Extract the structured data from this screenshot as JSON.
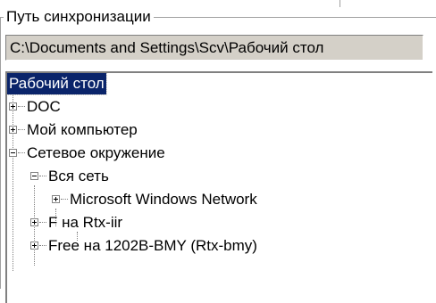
{
  "group": {
    "title": "Путь синхронизации",
    "path_value": "C:\\Documents and Settings\\Scv\\Рабочий стол"
  },
  "tree": {
    "root": "Рабочий стол",
    "items": [
      {
        "label": "DOC",
        "state": "collapsed"
      },
      {
        "label": "Мой компьютер",
        "state": "collapsed"
      },
      {
        "label": "Сетевое окружение",
        "state": "expanded"
      },
      {
        "label": "Вся сеть",
        "state": "expanded"
      },
      {
        "label": "Microsoft Windows Network",
        "state": "collapsed"
      },
      {
        "label": "F на Rtx-iir",
        "state": "collapsed"
      },
      {
        "label": "Free на 1202B-BMY (Rtx-bmy)",
        "state": "collapsed"
      }
    ]
  }
}
